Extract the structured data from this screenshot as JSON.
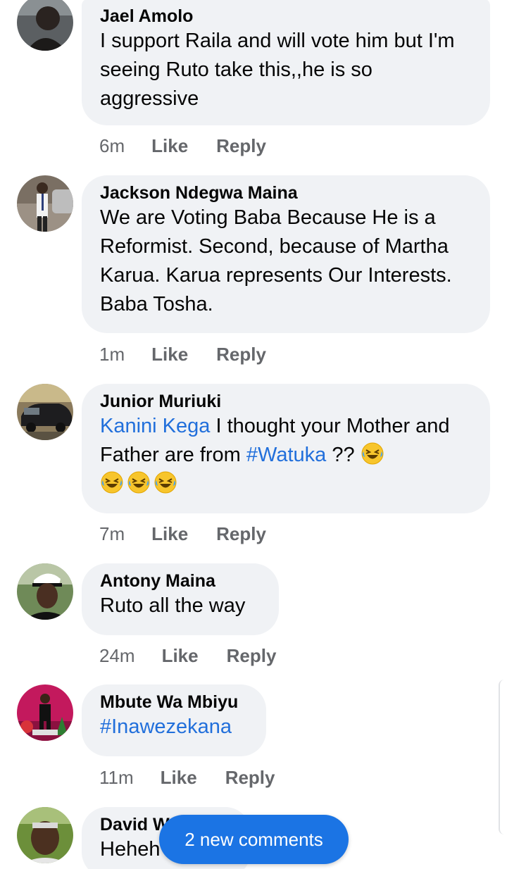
{
  "comments": [
    {
      "author": "Jael Amolo",
      "text": "I support Raila and will vote him but I'm seeing Ruto take this,,he is so aggressive",
      "time": "6m",
      "like": "Like",
      "reply": "Reply",
      "avatar_icon": "person-avatar"
    },
    {
      "author": "Jackson Ndegwa Maina",
      "text": "We are Voting Baba Because He is a Reformist. Second, because of Martha Karua. Karua represents Our Interests. Baba Tosha.",
      "time": "1m",
      "like": "Like",
      "reply": "Reply",
      "avatar_icon": "person-avatar"
    },
    {
      "author": "Junior Muriuki",
      "mention": "Kanini Kega",
      "text_a": " I thought your Mother and Father are from ",
      "hashtag": "#Watuka",
      "text_b": " ?? ",
      "emoji": "rolling-on-floor-laughing",
      "time": "7m",
      "like": "Like",
      "reply": "Reply",
      "avatar_icon": "car-avatar"
    },
    {
      "author": "Antony Maina",
      "text": "Ruto all the way",
      "time": "24m",
      "like": "Like",
      "reply": "Reply",
      "avatar_icon": "person-avatar"
    },
    {
      "author": "Mbute Wa Mbiyu",
      "hashtag": "#Inawezekana",
      "time": "11m",
      "like": "Like",
      "reply": "Reply",
      "avatar_icon": "person-avatar"
    },
    {
      "author": "David W",
      "text": "Heheh",
      "avatar_icon": "person-avatar"
    }
  ],
  "new_comments_label": "2 new comments",
  "colors": {
    "bubble": "#f0f2f5",
    "link": "#216fdb",
    "action": "#65676b",
    "pill": "#1b74e4"
  }
}
